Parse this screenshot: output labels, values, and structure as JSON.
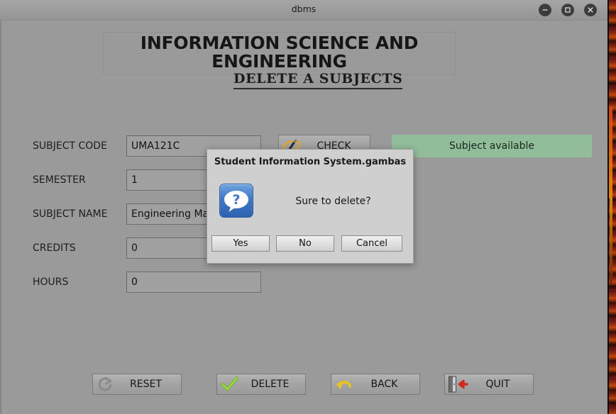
{
  "window": {
    "title": "dbms",
    "controls": [
      {
        "name": "minimize",
        "glyph": "minimize-icon"
      },
      {
        "name": "maximize",
        "glyph": "maximize-icon"
      },
      {
        "name": "close",
        "glyph": "close-icon"
      }
    ]
  },
  "header": {
    "title": "INFORMATION SCIENCE AND ENGINEERING",
    "subtitle": "DELETE A SUBJECTS"
  },
  "form": {
    "fields": [
      {
        "label": "SUBJECT CODE",
        "value": "UMA121C"
      },
      {
        "label": "SEMESTER",
        "value": "1"
      },
      {
        "label": "SUBJECT NAME",
        "value": "Engineering Mathematics"
      },
      {
        "label": "CREDITS",
        "value": "0"
      },
      {
        "label": "HOURS",
        "value": "0"
      }
    ]
  },
  "check": {
    "label": "CHECK",
    "icon": "magnifier-pencil-icon"
  },
  "status": {
    "text": "Subject available",
    "background": "#92bd9b",
    "color": "#17271a"
  },
  "actions": [
    {
      "label": "RESET",
      "icon": "refresh-circular-arrow-icon"
    },
    {
      "label": "DELETE",
      "icon": "green-check-icon"
    },
    {
      "label": "BACK",
      "icon": "yellow-undo-arrow-icon"
    },
    {
      "label": "QUIT",
      "icon": "exit-door-red-arrow-icon"
    }
  ],
  "dialog": {
    "title": "Student Information System.gambas",
    "message": "Sure to delete?",
    "icon": "question-speech-bubble-icon",
    "buttons": [
      {
        "label": "Yes"
      },
      {
        "label": "No"
      },
      {
        "label": "Cancel"
      }
    ]
  }
}
